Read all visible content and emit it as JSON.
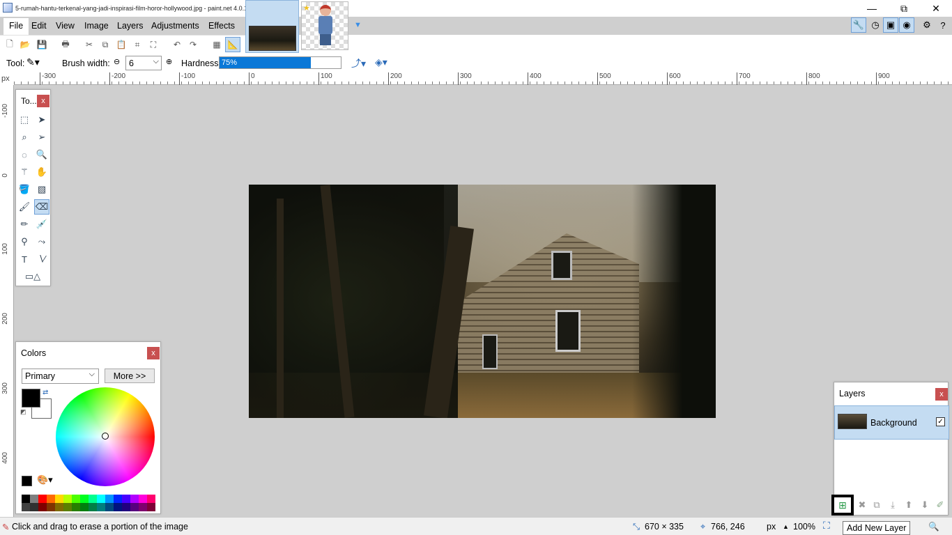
{
  "window": {
    "title": "5-rumah-hantu-terkenal-yang-jadi-inspirasi-film-horor-hollywood.jpg - paint.net 4.0.19",
    "minimize": "—",
    "maximize": "⧉",
    "close": "✕"
  },
  "menu": [
    "File",
    "Edit",
    "View",
    "Image",
    "Layers",
    "Adjustments",
    "Effects"
  ],
  "options": {
    "tool_label": "Tool:",
    "brush_width_label": "Brush width:",
    "brush_width_value": "6",
    "hardness_label": "Hardness:",
    "hardness_value": "75%",
    "hardness_fraction": 0.75
  },
  "ruler": {
    "unit": "px",
    "h_labels": [
      "-300",
      "-200",
      "-100",
      "0",
      "100",
      "200",
      "300",
      "400",
      "500",
      "600",
      "700",
      "800",
      "900"
    ],
    "v_labels": [
      "-100",
      "0",
      "100",
      "200",
      "300",
      "400"
    ]
  },
  "tools_panel": {
    "title": "To...",
    "close": "x"
  },
  "colors_panel": {
    "title": "Colors",
    "close": "x",
    "select_value": "Primary",
    "more_button": "More >>",
    "primary_color": "#000000",
    "secondary_color": "#ffffff",
    "palette_top": [
      "#000000",
      "#7f7f7f",
      "#ff0000",
      "#ff6a00",
      "#ffd800",
      "#b6ff00",
      "#4cff00",
      "#00ff21",
      "#00ff90",
      "#00ffff",
      "#0094ff",
      "#0026ff",
      "#4800ff",
      "#b200ff",
      "#ff00dc",
      "#ff006e"
    ],
    "palette_bottom": [
      "#404040",
      "#303030",
      "#7f0000",
      "#7f3300",
      "#7f6a00",
      "#5b7f00",
      "#267f00",
      "#007f0e",
      "#007f46",
      "#007f7f",
      "#004a7f",
      "#00137f",
      "#21007f",
      "#57007f",
      "#7f006e",
      "#7f0037"
    ]
  },
  "layers_panel": {
    "title": "Layers",
    "close": "x",
    "layers": [
      {
        "name": "Background",
        "visible": true
      }
    ]
  },
  "status": {
    "hint": "Click and drag to erase a portion of the image",
    "image_size": "670 × 335",
    "cursor_pos": "766, 246",
    "unit": "px",
    "zoom": "100%"
  },
  "tooltip": "Add New Layer"
}
